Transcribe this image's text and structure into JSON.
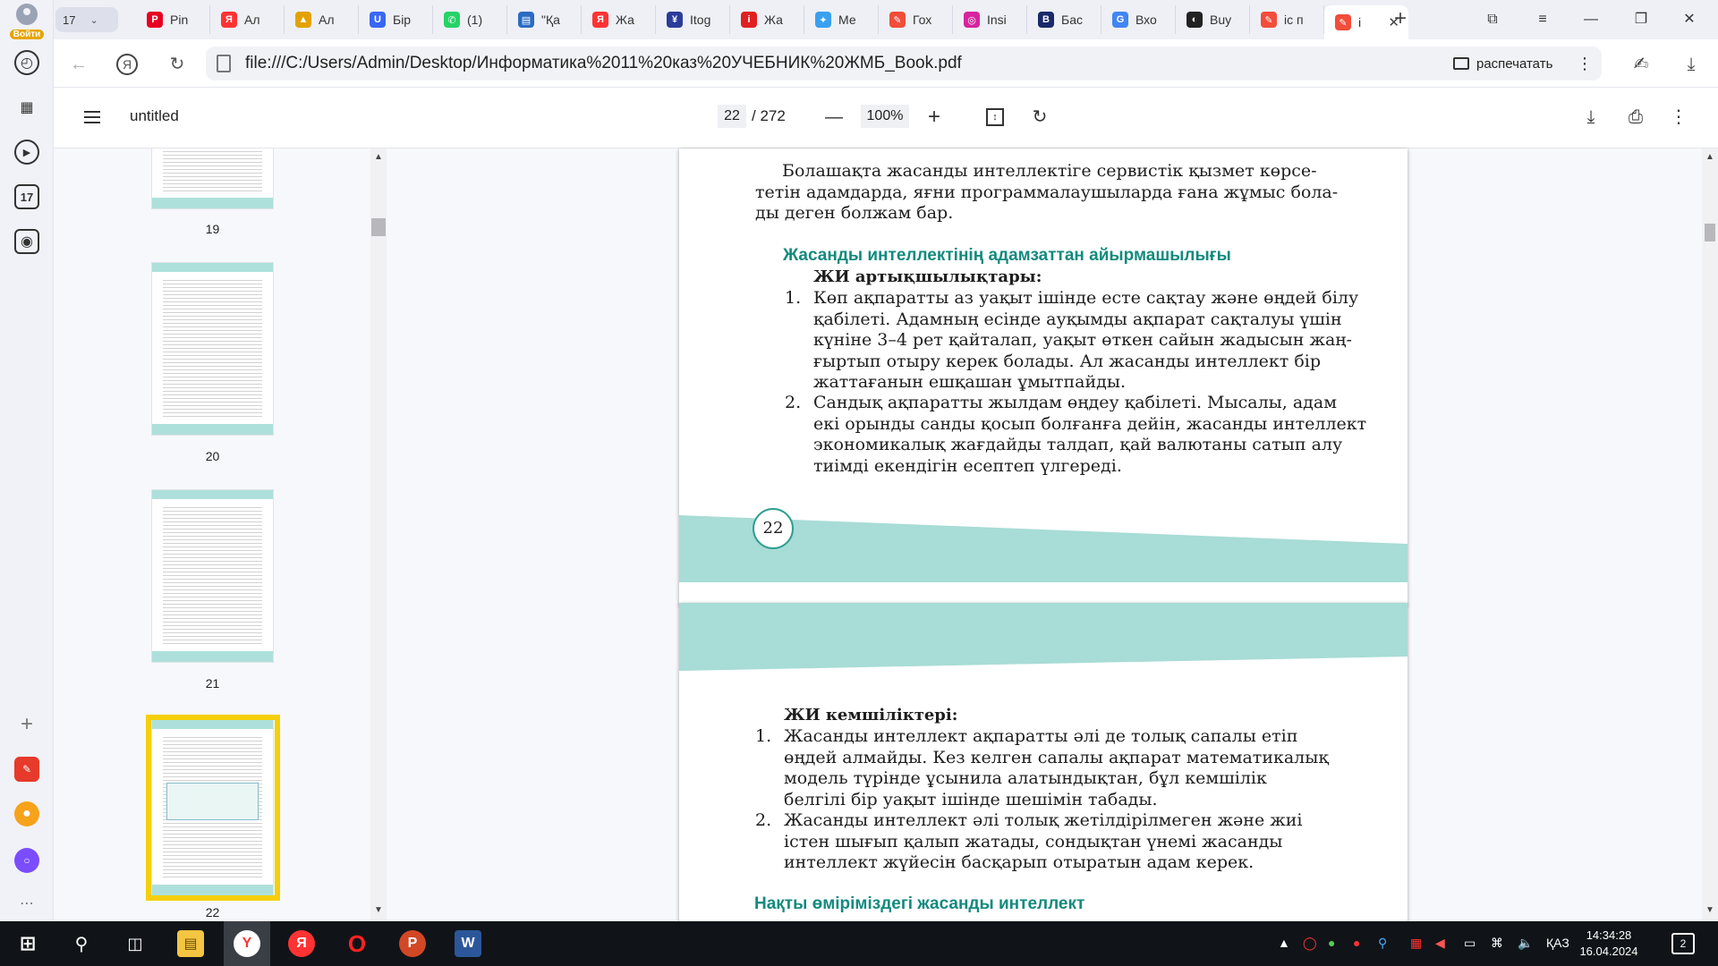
{
  "browser": {
    "profile_label": "Войти",
    "tab_count": "17",
    "tabs": [
      {
        "label": "Pin",
        "icon": "pinterest-icon",
        "color": "#e60023"
      },
      {
        "label": "Ал",
        "icon": "yandex-icon",
        "color": "#f33"
      },
      {
        "label": "Ал",
        "icon": "image-icon",
        "color": "#e3a200"
      },
      {
        "label": "Бір",
        "icon": "u-icon",
        "color": "#3867f4"
      },
      {
        "label": "(1)",
        "icon": "whatsapp-icon",
        "color": "#25d366"
      },
      {
        "label": "\"Қа",
        "icon": "book-icon",
        "color": "#2a6cc4"
      },
      {
        "label": "Жа",
        "icon": "yandex-icon",
        "color": "#f33"
      },
      {
        "label": "Itog",
        "icon": "itog-icon",
        "color": "#2b3c9a"
      },
      {
        "label": "Жа",
        "icon": "info-icon",
        "color": "#e02020"
      },
      {
        "label": "Ме",
        "icon": "apps-icon",
        "color": "#3aa0f0"
      },
      {
        "label": "Гох",
        "icon": "pdf-icon",
        "color": "#f24d3a"
      },
      {
        "label": "Insi",
        "icon": "instagram-icon",
        "color": "#d6249f"
      },
      {
        "label": "Бас",
        "icon": "bn-icon",
        "color": "#1a2a6a"
      },
      {
        "label": "Вхо",
        "icon": "google-icon",
        "color": "#4285f4"
      },
      {
        "label": "Buy",
        "icon": "buy-icon",
        "color": "#222"
      },
      {
        "label": "іс п",
        "icon": "pdf-icon",
        "color": "#f24d3a"
      },
      {
        "label": "і",
        "icon": "pdf-icon",
        "color": "#f24d3a",
        "active": true
      }
    ],
    "url": "file:///C:/Users/Admin/Desktop/Информатика%2011%20каз%20УЧЕБНИК%20ЖМБ_Book.pdf",
    "print_label": "распечатать"
  },
  "pdf_toolbar": {
    "title": "untitled",
    "current_page": "22",
    "total_pages": "/ 272",
    "zoom": "100%"
  },
  "thumbnails": [
    {
      "label": "19"
    },
    {
      "label": "20"
    },
    {
      "label": "21"
    },
    {
      "label": "22",
      "selected": true
    }
  ],
  "page1": {
    "intro_lines": [
      "Болашақта жасанды интеллектіге сервистік қызмет көрсе-",
      "тетін адамдарда, яғни программалаушыларда ғана жұмыс бола-",
      "ды деген болжам бар."
    ],
    "section_heading": "Жасанды интеллектінің адамзаттан айырмашылығы",
    "advantages_heading": "ЖИ артықшылықтары:",
    "items": [
      {
        "num": "1.",
        "lines": [
          "Көп ақпаратты аз уақыт ішінде есте сақтау және өңдей білу",
          "қабілеті. Адамның есінде ауқымды ақпарат сақталуы үшін",
          "күніне 3–4 рет қайталап, уақыт өткен сайын жадысын жаң-",
          "ғыртып отыру керек болады. Ал жасанды интеллект бір",
          "жаттағанын ешқашан ұмытпайды."
        ]
      },
      {
        "num": "2.",
        "lines": [
          "Сандық ақпаратты жылдам өңдеу қабілеті. Мысалы, адам",
          "екі орынды санды қосып болғанға дейін, жасанды интеллект",
          "экономикалық жағдайды талдап, қай валютаны сатып алу",
          "тиімді екендігін есептеп үлгереді."
        ]
      }
    ],
    "page_number": "22"
  },
  "page2": {
    "disadvantages_heading": "ЖИ кемшіліктері:",
    "items": [
      {
        "num": "1.",
        "lines": [
          "Жасанды интеллект ақпаратты әлі де толық сапалы етіп",
          "өңдей алмайды. Кез келген сапалы ақпарат математикалық",
          "модель түрінде ұсынила алатындықтан, бұл кемшілік",
          "белгілі бір уақыт ішінде шешімін табады."
        ]
      },
      {
        "num": "2.",
        "lines": [
          "Жасанды интеллект әлі толық жетілдірілмеген және жиі",
          "істен шығып қалып жатады, сондықтан үнемі жасанды",
          "интеллект жүйесін басқарып отыратын адам керек."
        ]
      }
    ],
    "section_heading": "Нақты өміріміздегі жасанды интеллект"
  },
  "taskbar": {
    "language": "ҚАЗ",
    "time": "14:34:28",
    "date": "16.04.2024",
    "notifications": "2"
  }
}
